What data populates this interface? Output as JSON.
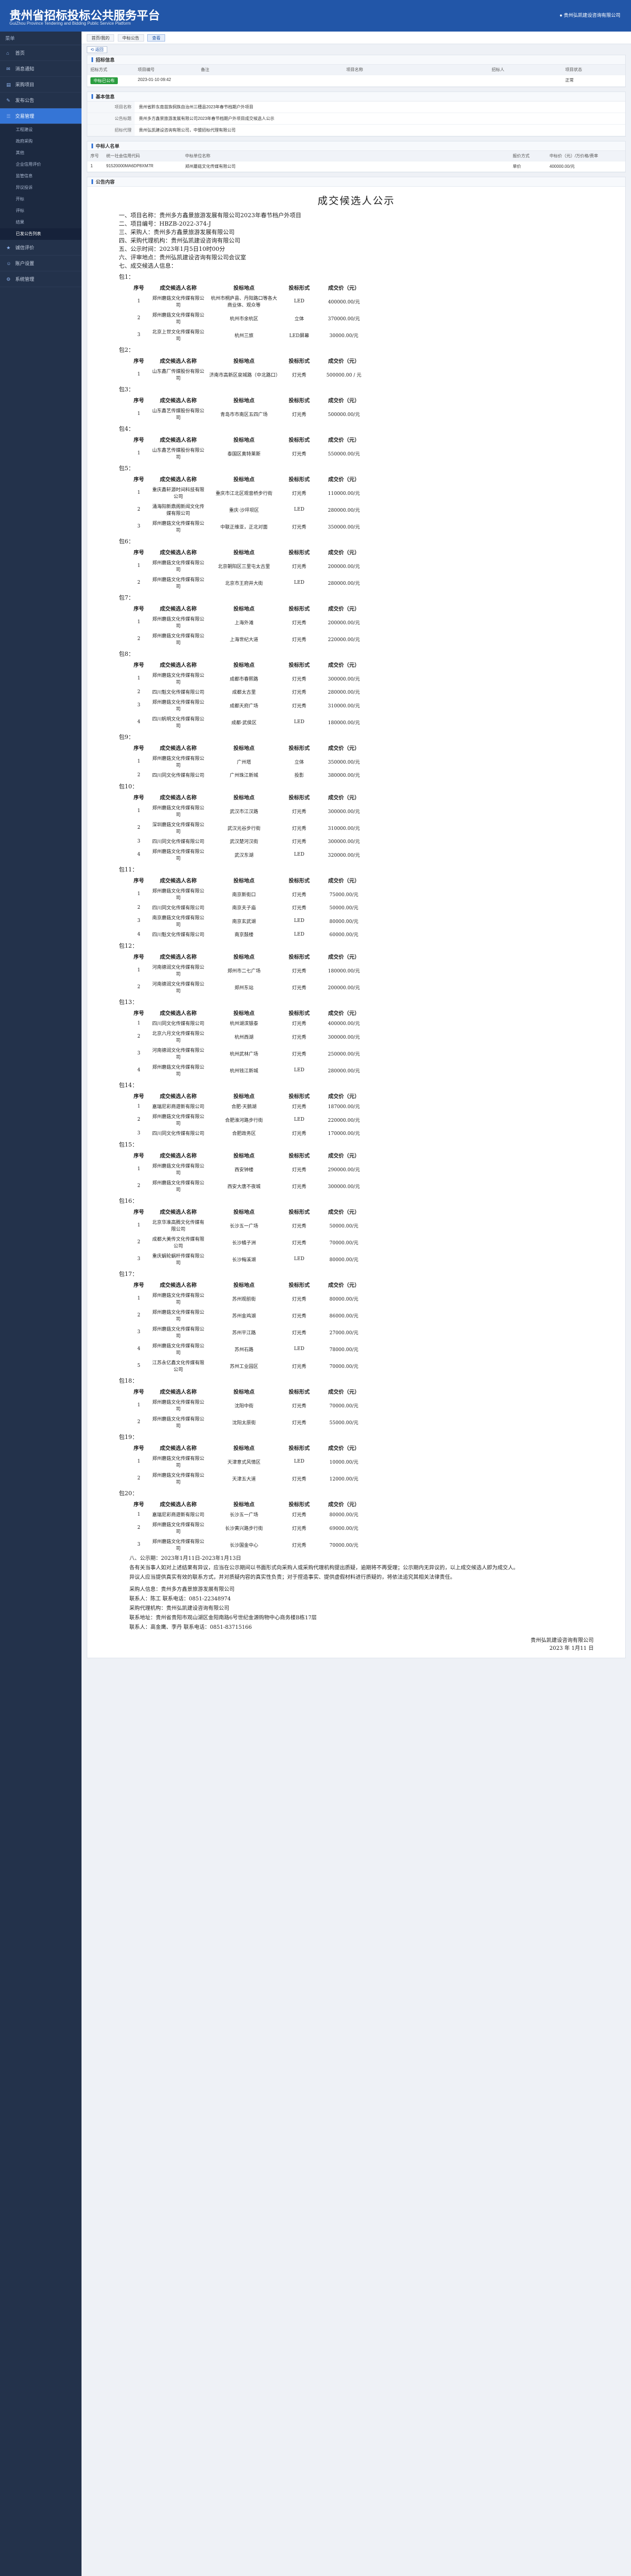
{
  "header": {
    "title": "贵州省招标投标公共服务平台",
    "subtitle": "GuiZhou Province Tendering and Bidding Public Service Platform",
    "user": "● 贵州弘凯建设咨询有限公司"
  },
  "sidebar": {
    "head": "菜单",
    "items": [
      {
        "label": "首页",
        "icon": "home-icon",
        "active": false
      },
      {
        "label": "消息通知",
        "icon": "bell-icon",
        "active": false
      },
      {
        "label": "采购项目",
        "icon": "doc-icon",
        "active": false
      },
      {
        "label": "发布公告",
        "icon": "edit-icon",
        "active": false
      },
      {
        "label": "交易管理",
        "icon": "list-icon",
        "active": true
      },
      {
        "label": "诚信评价",
        "icon": "star-icon",
        "active": false
      },
      {
        "label": "账户设置",
        "icon": "user-icon",
        "active": false
      },
      {
        "label": "系统管理",
        "icon": "gear-icon",
        "active": false
      }
    ],
    "subitems": [
      "工程建设",
      "政府采购",
      "其他",
      "企业信用评价",
      "监管信息",
      "异议投诉",
      "开标",
      "评标",
      "结果",
      "已发公告列表"
    ]
  },
  "tabs": [
    "首页/我的",
    "中标公告",
    "查看"
  ],
  "back_label": "返回",
  "proj": {
    "title": "招标信息",
    "cols": [
      "招标方式",
      "项目编号",
      "备注",
      "项目名称",
      "招标人",
      "项目状态"
    ],
    "row": [
      "公开招标",
      "2023-01-10 09:42",
      "",
      "",
      "",
      "正常"
    ],
    "status": "中标已公布"
  },
  "basic": {
    "title": "基本信息",
    "rows": [
      [
        "项目名称",
        "贵州省黔东南苗族侗族自治州三穗县2023年春节档期户外项目"
      ],
      [
        "公告标题",
        "贵州多方鑫景旅游发展有限公司2023年春节档期户外项目成交候选人公示"
      ],
      [
        "招标代理",
        "贵州弘凯建设咨询有限公司，中盟招标代理有限公司"
      ]
    ]
  },
  "winner": {
    "title": "中标人名单",
    "cols": [
      "序号",
      "统一社会信用代码",
      "中标单位名称",
      "",
      "",
      "",
      "",
      "报价方式",
      "中标价（元）/万价格/费率"
    ],
    "row": [
      "1",
      "91520000MA6DP8XM7R",
      "郑州蘑菇文化传媒有限公司",
      "",
      "",
      "",
      "",
      "单价",
      "400000.00/元"
    ]
  },
  "notice_title": "公告内容",
  "notice": {
    "heading": "成交候选人公示",
    "lines": [
      "一、项目名称：贵州多方鑫景旅游发展有限公司2023年春节档户外项目",
      "二、项目编号：HBZB-2022-374-J",
      "三、采购人：贵州多方鑫景旅游发展有限公司",
      "四、采购代理机构：贵州弘凯建设咨询有限公司",
      "五、公示时间：2023年1月5日10时00分",
      "六、评审地点：贵州弘凯建设咨询有限公司会议室",
      "七、成交候选人信息："
    ],
    "headers": [
      "序号",
      "成交候选人名称",
      "投标地点",
      "投标形式",
      "成交价（元）"
    ],
    "packages": [
      {
        "label": "包1：",
        "rows": [
          [
            "1",
            "郑州蘑菇文化传媒有限公司",
            "杭州市桐庐县、丹阳路口等各大商业体、观众等",
            "LED",
            "400000.00/元"
          ],
          [
            "2",
            "郑州蘑菇文化传媒有限公司",
            "杭州市余杭区",
            "立体",
            "370000.00/元"
          ],
          [
            "3",
            "北京上世文化传媒有限公司",
            "杭州三旅",
            "LED屏幕",
            "30000.00/元"
          ]
        ]
      },
      {
        "label": "包2：",
        "rows": [
          [
            "1",
            "山东鑫厂传媒股份有限公司",
            "济南市高新区泉城路（中北路口）",
            "灯光秀",
            "500000.00 / 元"
          ]
        ]
      },
      {
        "label": "包3：",
        "rows": [
          [
            "1",
            "山东鑫艺传媒股份有限公司",
            "青岛市市南区五四广场",
            "灯光秀",
            "500000.00/元"
          ]
        ]
      },
      {
        "label": "包4：",
        "rows": [
          [
            "1",
            "山东鑫艺传媒股份有限公司",
            "泰国区奥特莱斯",
            "灯光秀",
            "550000.00/元"
          ]
        ]
      },
      {
        "label": "包5：",
        "rows": [
          [
            "1",
            "重庆鑫轩源时间科技有限公司",
            "重庆市江北区观音桥步行街",
            "灯光秀",
            "110000.00/元"
          ],
          [
            "2",
            "涌海阳新鼎阁新闻文化传媒有限公司",
            "重庆·沙坪坝区",
            "LED",
            "280000.00/元"
          ],
          [
            "3",
            "郑州蘑菇文化传媒有限公司",
            "中联正维亚，正北对面",
            "灯光秀",
            "350000.00/元"
          ]
        ]
      },
      {
        "label": "包6：",
        "rows": [
          [
            "1",
            "郑州蘑菇文化传媒有限公司",
            "北京朝阳区三里屯太古里",
            "灯光秀",
            "200000.00/元"
          ],
          [
            "2",
            "郑州蘑菇文化传媒有限公司",
            "北京市王府井大街",
            "LED",
            "280000.00/元"
          ]
        ]
      },
      {
        "label": "包7：",
        "rows": [
          [
            "1",
            "郑州蘑菇文化传媒有限公司",
            "上海外滩",
            "灯光秀",
            "200000.00/元"
          ],
          [
            "2",
            "郑州蘑菇文化传媒有限公司",
            "上海世纪大道",
            "灯光秀",
            "220000.00/元"
          ]
        ]
      },
      {
        "label": "包8：",
        "rows": [
          [
            "1",
            "郑州蘑菇文化传媒有限公司",
            "成都市春熙路",
            "灯光秀",
            "300000.00/元"
          ],
          [
            "2",
            "四川魁文化传媒有限公司",
            "成都太古里",
            "灯光秀",
            "280000.00/元"
          ],
          [
            "3",
            "郑州蘑菇文化传媒有限公司",
            "成都天府广场",
            "灯光秀",
            "310000.00/元"
          ],
          [
            "4",
            "四川帆明文化传媒有限公司",
            "成都·武侯区",
            "LED",
            "180000.00/元"
          ]
        ]
      },
      {
        "label": "包9：",
        "rows": [
          [
            "1",
            "郑州蘑菇文化传媒有限公司",
            "广州塔",
            "立体",
            "350000.00/元"
          ],
          [
            "2",
            "四川同文化传媒有限公司",
            "广州珠江新城",
            "投影",
            "380000.00/元"
          ]
        ]
      },
      {
        "label": "包10：",
        "rows": [
          [
            "1",
            "郑州蘑菇文化传媒有限公司",
            "武汉市江汉路",
            "灯光秀",
            "300000.00/元"
          ],
          [
            "2",
            "深圳蘑菇文化传媒有限公司",
            "武汉光谷步行街",
            "灯光秀",
            "310000.00/元"
          ],
          [
            "3",
            "四川同文化传媒有限公司",
            "武汉楚河汉街",
            "灯光秀",
            "300000.00/元"
          ],
          [
            "4",
            "郑州蘑菇文化传媒有限公司",
            "武汉东湖",
            "LED",
            "320000.00/元"
          ]
        ]
      },
      {
        "label": "包11：",
        "rows": [
          [
            "1",
            "郑州蘑菇文化传媒有限公司",
            "南京新街口",
            "灯光秀",
            "75000.00/元"
          ],
          [
            "2",
            "四川同文化传媒有限公司",
            "南京夫子庙",
            "灯光秀",
            "50000.00/元"
          ],
          [
            "3",
            "南京蘑菇文化传媒有限公司",
            "南京玄武湖",
            "LED",
            "80000.00/元"
          ],
          [
            "4",
            "四川魁文化传媒有限公司",
            "南京鼓楼",
            "LED",
            "60000.00/元"
          ]
        ]
      },
      {
        "label": "包12：",
        "rows": [
          [
            "1",
            "河南德润文化传媒有限公司",
            "郑州市二七广场",
            "灯光秀",
            "180000.00/元"
          ],
          [
            "2",
            "河南德润文化传媒有限公司",
            "郑州东站",
            "灯光秀",
            "200000.00/元"
          ]
        ]
      },
      {
        "label": "包13：",
        "rows": [
          [
            "1",
            "四川同文化传媒有限公司",
            "杭州湖滨银泰",
            "灯光秀",
            "400000.00/元"
          ],
          [
            "2",
            "北京六月文化传媒有限公司",
            "杭州西湖",
            "灯光秀",
            "300000.00/元"
          ],
          [
            "3",
            "河南德润文化传媒有限公司",
            "杭州武林广场",
            "灯光秀",
            "250000.00/元"
          ],
          [
            "4",
            "郑州蘑菇文化传媒有限公司",
            "杭州钱江新城",
            "LED",
            "280000.00/元"
          ]
        ]
      },
      {
        "label": "包14：",
        "rows": [
          [
            "1",
            "嘉瑞尼彩商遊新有限公司",
            "合肥·天鹅湖",
            "灯光秀",
            "187000.00/元"
          ],
          [
            "2",
            "郑州蘑菇文化传媒有限公司",
            "合肥淮河路步行街",
            "LED",
            "220000.00/元"
          ],
          [
            "3",
            "四川同文化传媒有限公司",
            "合肥政务区",
            "灯光秀",
            "170000.00/元"
          ]
        ]
      },
      {
        "label": "包15：",
        "rows": [
          [
            "1",
            "郑州蘑菇文化传媒有限公司",
            "西安钟楼",
            "灯光秀",
            "290000.00/元"
          ],
          [
            "2",
            "郑州蘑菇文化传媒有限公司",
            "西安大唐不夜城",
            "灯光秀",
            "300000.00/元"
          ]
        ]
      },
      {
        "label": "包16：",
        "rows": [
          [
            "1",
            "北京华准高腾文化传媒有限公司",
            "长沙五一广场",
            "灯光秀",
            "50000.00/元"
          ],
          [
            "2",
            "成都大美传文化传媒有限公司",
            "长沙橘子洲",
            "灯光秀",
            "70000.00/元"
          ],
          [
            "3",
            "重庆蜗轮蜗杆传媒有限公司",
            "长沙梅溪湖",
            "LED",
            "80000.00/元"
          ]
        ]
      },
      {
        "label": "包17：",
        "rows": [
          [
            "1",
            "郑州蘑菇文化传媒有限公司",
            "苏州观前街",
            "灯光秀",
            "80000.00/元"
          ],
          [
            "2",
            "郑州蘑菇文化传媒有限公司",
            "苏州金鸡湖",
            "灯光秀",
            "86000.00/元"
          ],
          [
            "3",
            "郑州蘑菇文化传媒有限公司",
            "苏州平江路",
            "灯光秀",
            "27000.00/元"
          ],
          [
            "4",
            "郑州蘑菇文化传媒有限公司",
            "苏州石路",
            "LED",
            "78000.00/元"
          ],
          [
            "5",
            "江苏永亿鑫文化传媒有限公司",
            "苏州工业园区",
            "灯光秀",
            "70000.00/元"
          ]
        ]
      },
      {
        "label": "包18：",
        "rows": [
          [
            "1",
            "郑州蘑菇文化传媒有限公司",
            "沈阳中街",
            "灯光秀",
            "70000.00/元"
          ],
          [
            "2",
            "郑州蘑菇文化传媒有限公司",
            "沈阳太原街",
            "灯光秀",
            "55000.00/元"
          ]
        ]
      },
      {
        "label": "包19：",
        "rows": [
          [
            "1",
            "郑州蘑菇文化传媒有限公司",
            "天津意式风情区",
            "LED",
            "10000.00/元"
          ],
          [
            "2",
            "郑州蘑菇文化传媒有限公司",
            "天津五大道",
            "灯光秀",
            "12000.00/元"
          ]
        ]
      },
      {
        "label": "包20：",
        "rows": [
          [
            "1",
            "嘉瑞尼彩商遊新有限公司",
            "长沙五一广场",
            "灯光秀",
            "80000.00/元"
          ],
          [
            "2",
            "郑州蘑菇文化传媒有限公司",
            "长沙黄兴路步行街",
            "灯光秀",
            "69000.00/元"
          ],
          [
            "3",
            "郑州蘑菇文化传媒有限公司",
            "长沙国金中心",
            "灯光秀",
            "70000.00/元"
          ]
        ]
      }
    ],
    "paragraphs": [
      "八、公示期：2023年1月11日-2023年1月13日",
      "各有关当事人如对上述结果有异议，应当在公示期间以书面形式向采购人或采购代理机构提出质疑，逾期将不再受理；公示期内无异议的，以上成交候选人即为成交人。",
      "异议人应当提供真实有效的联系方式，并对质疑内容的真实性负责；对于捏造事实、提供虚假材料进行质疑的，将依法追究其相关法律责任。"
    ],
    "contacts": [
      "采购人信息：贵州多方鑫景旅游发展有限公司",
      "联系人：陈工    联系电话：0851-22348974",
      "采购代理机构：贵州弘凯建设咨询有限公司",
      "联系地址：贵州省贵阳市观山湖区金阳南路6号世纪金源购物中心商务楼B栋17层",
      "联系人：高金鹰、李丹    联系电话：0851-83715166"
    ],
    "sign": [
      "贵州弘凯建设咨询有限公司",
      "2023 年 1月11 日"
    ]
  }
}
